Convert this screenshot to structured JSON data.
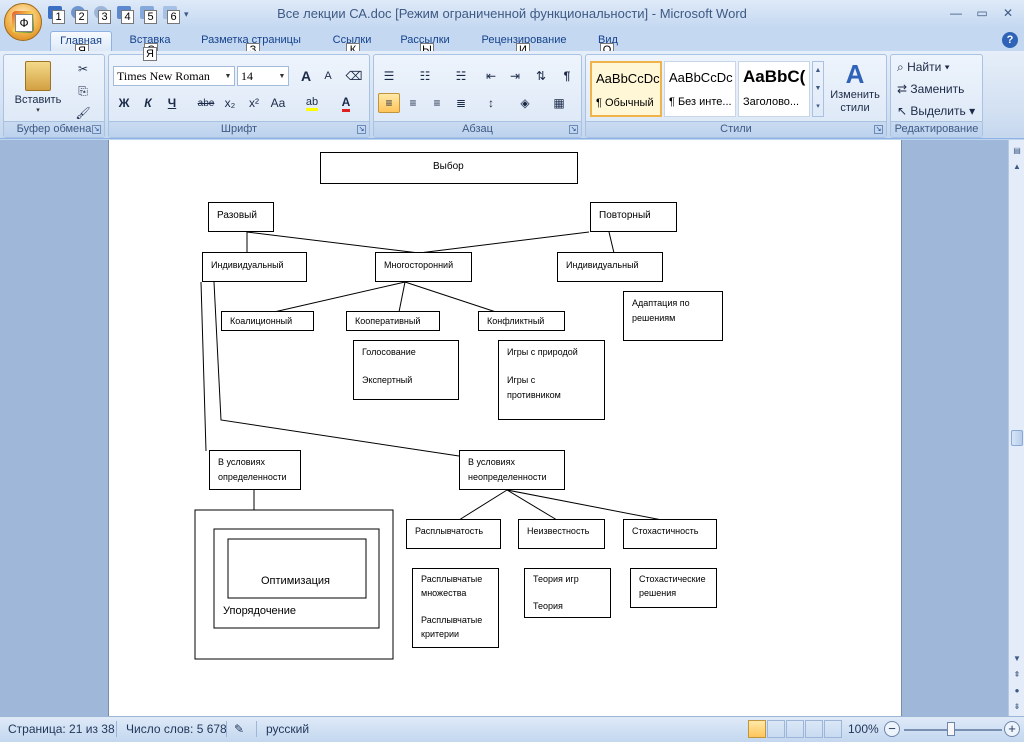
{
  "window": {
    "title": "Все лекции СА.doc [Режим ограниченной функциональности] - Microsoft Word",
    "office_key": "Ф",
    "qat_keys": [
      "1",
      "2",
      "3",
      "4",
      "5",
      "6"
    ],
    "controls": {
      "minimize": "—",
      "maximize": "▭",
      "close": "✕"
    }
  },
  "tabs": [
    {
      "label": "Главная",
      "key": "Я",
      "active": true
    },
    {
      "label": "Вставка",
      "key": "С"
    },
    {
      "label": "Разметка страницы",
      "key": "З"
    },
    {
      "label": "Ссылки",
      "key": "К"
    },
    {
      "label": "Рассылки",
      "key": "Ы"
    },
    {
      "label": "Рецензирование",
      "key": "И"
    },
    {
      "label": "Вид",
      "key": "О"
    }
  ],
  "ribbon": {
    "clipboard": {
      "label": "Буфер обмена",
      "paste": "Вставить"
    },
    "font": {
      "label": "Шрифт",
      "family": "Times New Roman",
      "size": "14",
      "bold": "Ж",
      "italic": "К",
      "underline": "Ч",
      "strike": "abe",
      "subscript": "x₂",
      "superscript": "x²",
      "case": "Aa",
      "grow": "A",
      "shrink": "A"
    },
    "paragraph": {
      "label": "Абзац"
    },
    "styles": {
      "label": "Стили",
      "tiles": [
        {
          "sample": "AaBbCcDc",
          "name": "¶ Обычный",
          "selected": true
        },
        {
          "sample": "AaBbCcDc",
          "name": "¶ Без инте..."
        },
        {
          "sample": "AaBbC(",
          "name": "Заголово..."
        }
      ],
      "change": "Изменить стили"
    },
    "editing": {
      "label": "Редактирование",
      "find": "Найти",
      "replace": "Заменить",
      "select": "Выделить"
    }
  },
  "diagram": {
    "choice": "Выбор",
    "one_time": "Разовый",
    "repeated": "Повторный",
    "individual_left": "Индивидуальный",
    "multilateral": "Многосторонний",
    "individual_right": "Индивидуальный",
    "adaptation": [
      "Адаптация по",
      "решениям"
    ],
    "coalition": "Коалиционный",
    "cooperative": "Кооперативный",
    "conflict": "Конфликтный",
    "voting": "Голосование",
    "expert": "Экспертный",
    "games_nature": "Игры с природой",
    "games_opponent": [
      "Игры с",
      "противником"
    ],
    "certainty": [
      "В условиях",
      "определенности"
    ],
    "uncertainty": [
      "В условиях",
      "неопределенности"
    ],
    "fuzziness": "Расплывчатость",
    "unknown": "Неизвестность",
    "stochasticity": "Стохастичность",
    "optimization": "Оптимизация",
    "ordering": "Упорядочение",
    "fuzzy_sets": [
      "Расплывчатые",
      "множества"
    ],
    "fuzzy_criteria": [
      "Расплывчатые",
      "критерии"
    ],
    "game_theory": "Теория игр",
    "theory": "Теория",
    "stochastic_solutions": [
      "Стохастические",
      "решения"
    ]
  },
  "status": {
    "page": "Страница: 21 из 38",
    "words": "Число слов: 5 678",
    "language": "русский",
    "zoom": "100%",
    "zoom_level": 1.0
  }
}
